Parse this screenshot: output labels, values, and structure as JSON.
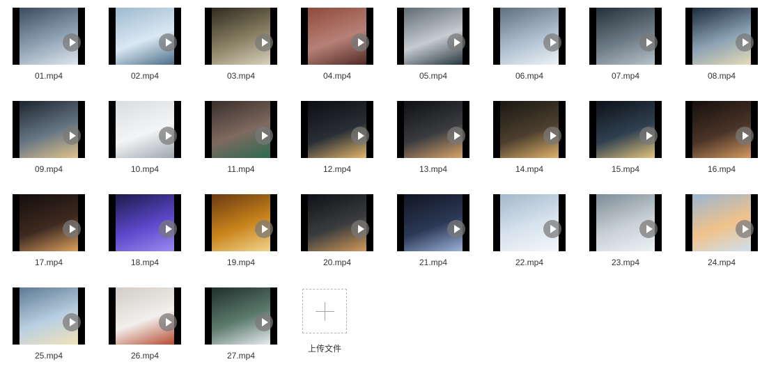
{
  "files": [
    {
      "name": "01.mp4",
      "colors": [
        "#3b4b5d",
        "#8fa2b3",
        "#dfe6ee"
      ]
    },
    {
      "name": "02.mp4",
      "colors": [
        "#9fb9cf",
        "#d9e8f3",
        "#4c6d86"
      ]
    },
    {
      "name": "03.mp4",
      "colors": [
        "#2f2a20",
        "#8b8063",
        "#d8d1bd"
      ]
    },
    {
      "name": "04.mp4",
      "colors": [
        "#8e4a3a",
        "#b78177",
        "#4f2a23"
      ]
    },
    {
      "name": "05.mp4",
      "colors": [
        "#606b72",
        "#c6ccd0",
        "#27363f"
      ]
    },
    {
      "name": "06.mp4",
      "colors": [
        "#5e6f7e",
        "#aebecf",
        "#edf2f6"
      ]
    },
    {
      "name": "07.mp4",
      "colors": [
        "#242f39",
        "#6d7b86",
        "#b6c2c8"
      ]
    },
    {
      "name": "08.mp4",
      "colors": [
        "#1a2b3d",
        "#8ba1b3",
        "#e6dbb7"
      ]
    },
    {
      "name": "09.mp4",
      "colors": [
        "#1c252f",
        "#677684",
        "#e1c38a"
      ]
    },
    {
      "name": "10.mp4",
      "colors": [
        "#d9dde0",
        "#f3f4f5",
        "#9ea7ae"
      ]
    },
    {
      "name": "11.mp4",
      "colors": [
        "#3a2e2a",
        "#7e6a60",
        "#2b6a4f"
      ]
    },
    {
      "name": "12.mp4",
      "colors": [
        "#0b0d12",
        "#2a2f35",
        "#e2b76d"
      ]
    },
    {
      "name": "13.mp4",
      "colors": [
        "#0f1015",
        "#3a3b3f",
        "#d8a569"
      ]
    },
    {
      "name": "14.mp4",
      "colors": [
        "#1a1712",
        "#4c3f2e",
        "#e1b36a"
      ]
    },
    {
      "name": "15.mp4",
      "colors": [
        "#0c1118",
        "#304050",
        "#e2c57c"
      ]
    },
    {
      "name": "16.mp4",
      "colors": [
        "#160f0c",
        "#4a3428",
        "#d39861"
      ]
    },
    {
      "name": "17.mp4",
      "colors": [
        "#140d0b",
        "#3e2a20",
        "#dca061"
      ]
    },
    {
      "name": "18.mp4",
      "colors": [
        "#1d1a4b",
        "#5c47c9",
        "#9a8bf0"
      ]
    },
    {
      "name": "19.mp4",
      "colors": [
        "#6a3a12",
        "#c9841b",
        "#f0d48f"
      ]
    },
    {
      "name": "20.mp4",
      "colors": [
        "#0e1116",
        "#3b3c3e",
        "#d19a5a"
      ]
    },
    {
      "name": "21.mp4",
      "colors": [
        "#101522",
        "#2c3956",
        "#9bb2d9"
      ]
    },
    {
      "name": "22.mp4",
      "colors": [
        "#a2b8c9",
        "#d8e3ee",
        "#f4f7fa"
      ]
    },
    {
      "name": "23.mp4",
      "colors": [
        "#7d8b95",
        "#c9d1d7",
        "#eef2f4"
      ]
    },
    {
      "name": "24.mp4",
      "colors": [
        "#9bb6d1",
        "#f0c28b",
        "#cfe0ef"
      ]
    },
    {
      "name": "25.mp4",
      "colors": [
        "#5d7a93",
        "#b9d0e2",
        "#f2e2b8"
      ]
    },
    {
      "name": "26.mp4",
      "colors": [
        "#d1ccc7",
        "#f2efec",
        "#b64b2f"
      ]
    },
    {
      "name": "27.mp4",
      "colors": [
        "#1e2f2a",
        "#5e7b6f",
        "#e7ecef"
      ]
    }
  ],
  "upload": {
    "label": "上传文件"
  }
}
